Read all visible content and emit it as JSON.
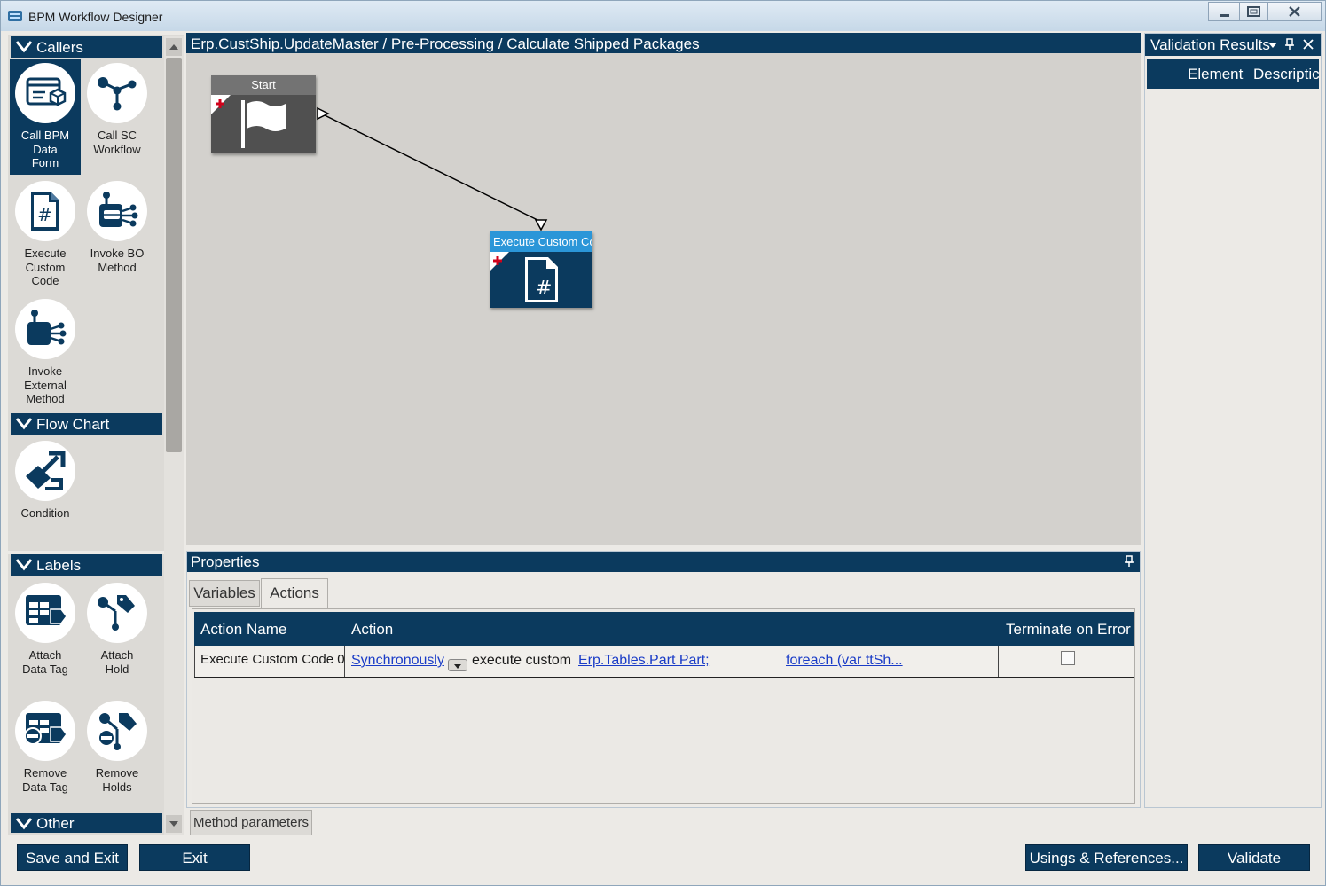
{
  "window": {
    "title": "BPM Workflow Designer"
  },
  "toolbox": {
    "callers": {
      "header": "Callers",
      "items": [
        {
          "label_lines": [
            "Call BPM",
            "Data",
            "Form"
          ]
        },
        {
          "label_lines": [
            "Call SC",
            "Workflow"
          ]
        },
        {
          "label_lines": [
            "Execute",
            "Custom",
            "Code"
          ]
        },
        {
          "label_lines": [
            "Invoke BO",
            "Method"
          ]
        },
        {
          "label_lines": [
            "Invoke",
            "External",
            "Method"
          ]
        }
      ]
    },
    "flowchart": {
      "header": "Flow Chart",
      "items": [
        {
          "label": "Condition"
        }
      ]
    },
    "labels": {
      "header": "Labels",
      "items": [
        {
          "label_lines": [
            "Attach",
            "Data Tag"
          ]
        },
        {
          "label_lines": [
            "Attach",
            "Hold"
          ]
        },
        {
          "label_lines": [
            "Remove",
            "Data Tag"
          ]
        },
        {
          "label_lines": [
            "Remove",
            "Holds"
          ]
        }
      ]
    },
    "other": {
      "header": "Other"
    }
  },
  "designer": {
    "breadcrumb": "Erp.CustShip.UpdateMaster / Pre-Processing / Calculate Shipped Packages",
    "nodes": {
      "start": {
        "label": "Start"
      },
      "custom": {
        "label": "Execute Custom Cc"
      }
    }
  },
  "validation": {
    "header": "Validation Results",
    "columns": [
      "Element",
      "Descriptic"
    ]
  },
  "properties": {
    "header": "Properties",
    "tabs": [
      "Variables",
      "Actions"
    ],
    "table": {
      "headers": [
        "Action Name",
        "Action",
        "Terminate on Error"
      ],
      "rows": [
        {
          "name": "Execute Custom Code 0",
          "mode": "Synchronously",
          "middle": "execute custom",
          "ref": "Erp.Tables.Part Part;",
          "code": "foreach (var ttSh...",
          "terminate": false
        }
      ]
    },
    "method_tab": "Method parameters"
  },
  "footer": {
    "save_exit": "Save and Exit",
    "exit": "Exit",
    "usings": "Usings & References...",
    "validate": "Validate"
  }
}
